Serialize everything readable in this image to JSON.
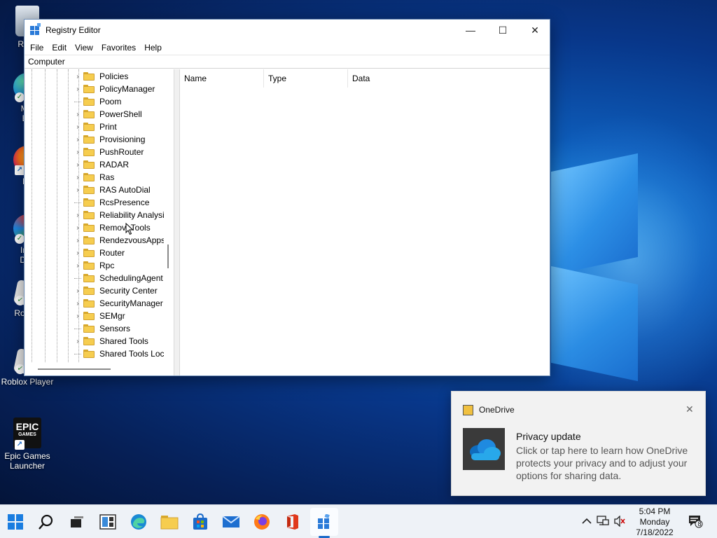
{
  "desktop": {
    "icons": [
      {
        "label": "Recy",
        "icon": "recycle-bin-icon"
      },
      {
        "label": "Mic",
        "label2": "Ed",
        "icon": "edge-icon"
      },
      {
        "label": "Fir",
        "icon": "firefox-icon"
      },
      {
        "label": "Inte",
        "label2": "Dov",
        "icon": "download-icon"
      },
      {
        "label": "Roblox",
        "icon": "roblox-studio-icon"
      },
      {
        "label": "Roblox Player",
        "icon": "roblox-player-icon"
      },
      {
        "label": "Epic Games",
        "label2": "Launcher",
        "icon": "epic-games-icon",
        "logo_text": "EPIC",
        "logo_sub": "GAMES"
      }
    ]
  },
  "window": {
    "title": "Registry Editor",
    "controls": {
      "minimize": "—",
      "maximize": "☐",
      "close": "✕"
    },
    "menu": [
      "File",
      "Edit",
      "View",
      "Favorites",
      "Help"
    ],
    "address": "Computer",
    "tree_items": [
      {
        "label": "Policies",
        "expandable": true
      },
      {
        "label": "PolicyManager",
        "expandable": true
      },
      {
        "label": "Poom",
        "expandable": false
      },
      {
        "label": "PowerShell",
        "expandable": true
      },
      {
        "label": "Print",
        "expandable": true
      },
      {
        "label": "Provisioning",
        "expandable": true
      },
      {
        "label": "PushRouter",
        "expandable": true
      },
      {
        "label": "RADAR",
        "expandable": true
      },
      {
        "label": "Ras",
        "expandable": true
      },
      {
        "label": "RAS AutoDial",
        "expandable": true
      },
      {
        "label": "RcsPresence",
        "expandable": false
      },
      {
        "label": "Reliability Analysi",
        "expandable": true
      },
      {
        "label": "RemoveTools",
        "expandable": true
      },
      {
        "label": "RendezvousApps",
        "expandable": true
      },
      {
        "label": "Router",
        "expandable": true
      },
      {
        "label": "Rpc",
        "expandable": true
      },
      {
        "label": "SchedulingAgent",
        "expandable": false
      },
      {
        "label": "Security Center",
        "expandable": true
      },
      {
        "label": "SecurityManager",
        "expandable": true
      },
      {
        "label": "SEMgr",
        "expandable": true
      },
      {
        "label": "Sensors",
        "expandable": false
      },
      {
        "label": "Shared Tools",
        "expandable": true
      },
      {
        "label": "Shared Tools Loca",
        "expandable": false
      }
    ],
    "columns": [
      "Name",
      "Type",
      "Data"
    ]
  },
  "toast": {
    "app": "OneDrive",
    "close": "✕",
    "title": "Privacy update",
    "body": "Click or tap here to learn how OneDrive protects your privacy and to adjust your options for sharing data."
  },
  "taskbar": {
    "apps": [
      "start-icon",
      "search-icon",
      "task-view-icon",
      "widgets-icon",
      "edge-icon",
      "file-explorer-icon",
      "store-icon",
      "mail-icon",
      "firefox-icon",
      "office-icon",
      "registry-editor-icon"
    ],
    "active_app": "registry-editor-icon",
    "clock": {
      "time": "5:04 PM",
      "day": "Monday",
      "date": "7/18/2022"
    },
    "notification_count": "8"
  },
  "colors": {
    "accent": "#1b6ac9",
    "folder": "#f6cd4f"
  }
}
